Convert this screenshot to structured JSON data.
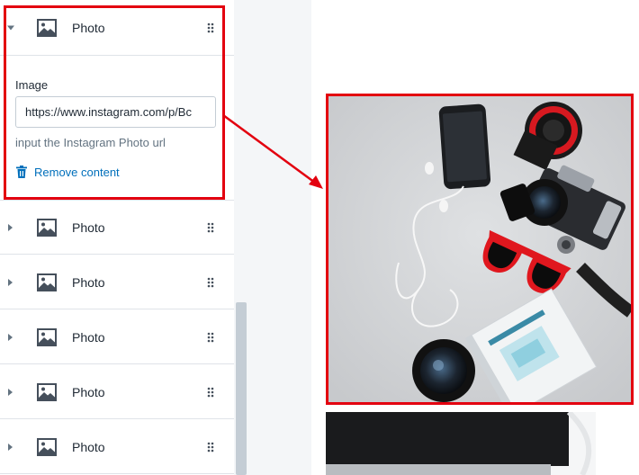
{
  "blocks": [
    {
      "label": "Photo",
      "expanded": true
    },
    {
      "label": "Photo",
      "expanded": false
    },
    {
      "label": "Photo",
      "expanded": false
    },
    {
      "label": "Photo",
      "expanded": false
    },
    {
      "label": "Photo",
      "expanded": false
    },
    {
      "label": "Photo",
      "expanded": false
    }
  ],
  "editor": {
    "image_label": "Image",
    "url_value": "https://www.instagram.com/p/Bc",
    "help_text": "input the Instagram Photo url",
    "remove_label": "Remove content"
  },
  "icons": {
    "block_icon": "image-icon",
    "drag_icon": "drag-handle-icon",
    "remove_icon": "trash-icon"
  },
  "colors": {
    "highlight": "#e3000f",
    "link": "#006fbb"
  }
}
